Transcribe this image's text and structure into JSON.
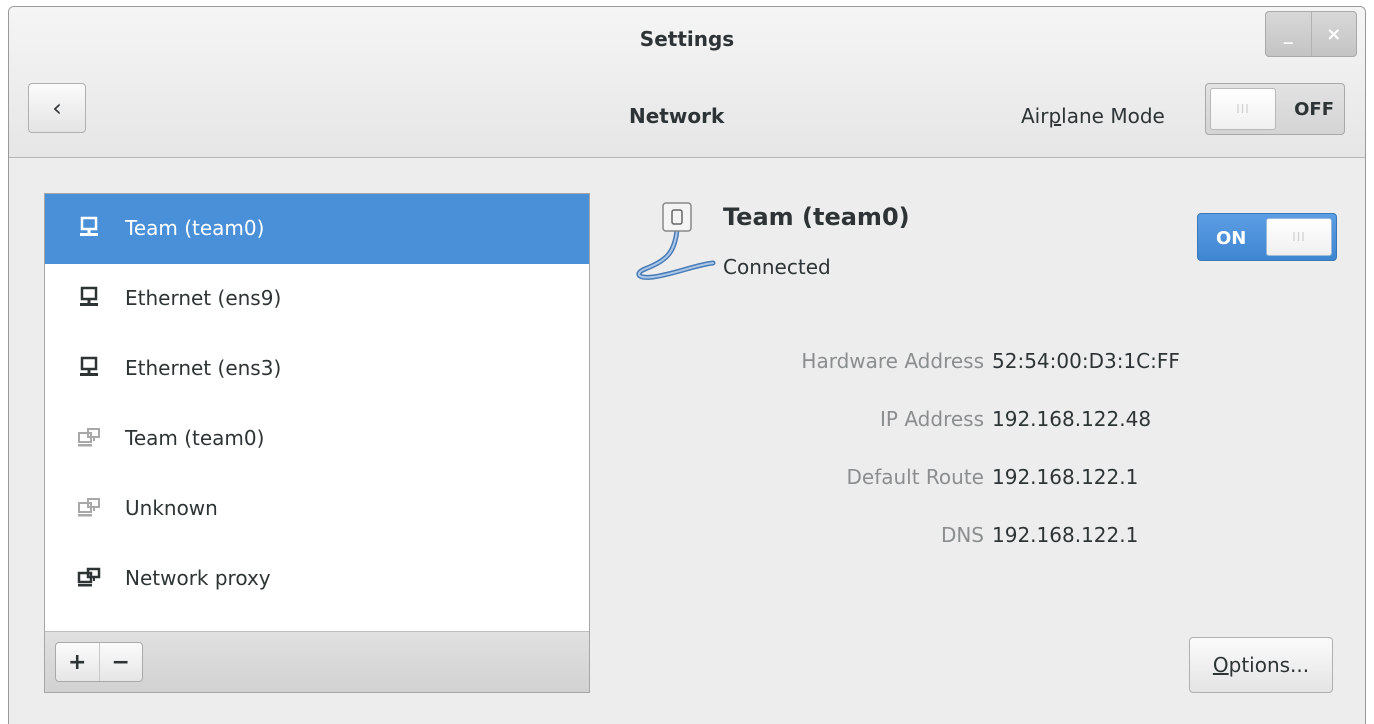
{
  "window": {
    "title": "Settings",
    "minimize_glyph": "_",
    "close_glyph": "×"
  },
  "header": {
    "back_glyph": "‹",
    "title": "Network",
    "airplane_pre": "Air",
    "airplane_mnemonic": "p",
    "airplane_post": "lane Mode",
    "airplane_state": "OFF",
    "switch_grip": "III"
  },
  "sidebar": {
    "items": [
      {
        "label": "Team (team0)",
        "icon": "wired-network-icon",
        "selected": true
      },
      {
        "label": "Ethernet (ens9)",
        "icon": "wired-network-icon",
        "selected": false
      },
      {
        "label": "Ethernet (ens3)",
        "icon": "wired-network-icon",
        "selected": false
      },
      {
        "label": "Team (team0)",
        "icon": "network-inactive-icon",
        "selected": false
      },
      {
        "label": "Unknown",
        "icon": "network-inactive-icon",
        "selected": false
      },
      {
        "label": "Network proxy",
        "icon": "network-proxy-icon",
        "selected": false
      }
    ],
    "add_label": "+",
    "remove_label": "−"
  },
  "connection": {
    "name": "Team (team0)",
    "status": "Connected",
    "switch_state": "ON",
    "switch_grip": "III"
  },
  "details": [
    {
      "key": "Hardware Address",
      "value": "52:54:00:D3:1C:FF"
    },
    {
      "key": "IP Address",
      "value": "192.168.122.48"
    },
    {
      "key": "Default Route",
      "value": "192.168.122.1"
    },
    {
      "key": "DNS",
      "value": "192.168.122.1"
    }
  ],
  "options": {
    "mnemonic": "O",
    "rest": "ptions..."
  },
  "colors": {
    "accent": "#4a90d9",
    "background": "#ededed",
    "muted_text": "#8b8e8f"
  }
}
